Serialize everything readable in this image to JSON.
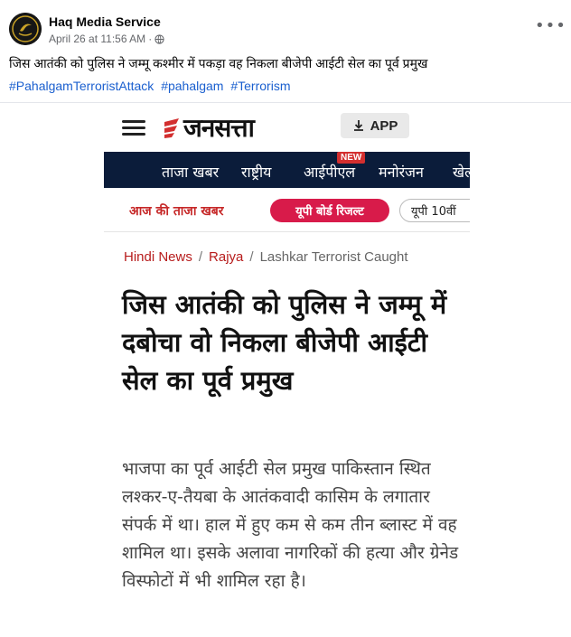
{
  "post": {
    "author": "Haq Media Service",
    "timestamp": "April 26 at 11:56 AM",
    "separator": "·",
    "privacy_icon": "globe-icon",
    "more_label": "•••",
    "caption": "जिस आतंकी को पुलिस ने जम्मू कश्मीर में पकड़ा वह निकला बीजेपी आईटी सेल का पूर्व प्रमुख",
    "hashtags": [
      "#PahalgamTerroristAttack",
      "#pahalgam",
      "#Terrorism"
    ]
  },
  "article_screenshot": {
    "site_logo": "जनसत्ता",
    "app_button": "APP",
    "nav_items": [
      "ताजा खबर",
      "राष्ट्रीय",
      "आईपीएल",
      "मनोरंजन",
      "खेल"
    ],
    "nav_badge": "NEW",
    "quicklinks": {
      "label": "आज की ताजा खबर",
      "pill": "यूपी बोर्ड रिजल्ट",
      "pill2": "यूपी 10वीं"
    },
    "breadcrumb": [
      "Hindi News",
      "Rajya",
      "Lashkar Terrorist Caught"
    ],
    "breadcrumb_separator": "/",
    "headline": "जिस आतंकी को पुलिस ने जम्मू में दबोचा वो निकला बीजेपी आईटी सेल का पूर्व प्रमुख",
    "summary": "भाजपा का पूर्व आईटी सेल प्रमुख पाकिस्तान स्थित लश्कर-ए-तैयबा के आतंकवादी कासिम के लगातार संपर्क में था। हाल में हुए कम से कम तीन ब्लास्ट में वह शामिल था। इसके अलावा नागरिकों की हत्या और ग्रेनेड विस्फोटों में भी शामिल रहा है।"
  },
  "colors": {
    "link": "#1a5fcf",
    "nav_bg": "#0b1c3a",
    "brand_red": "#c62828",
    "pill": "#d81b4a"
  }
}
